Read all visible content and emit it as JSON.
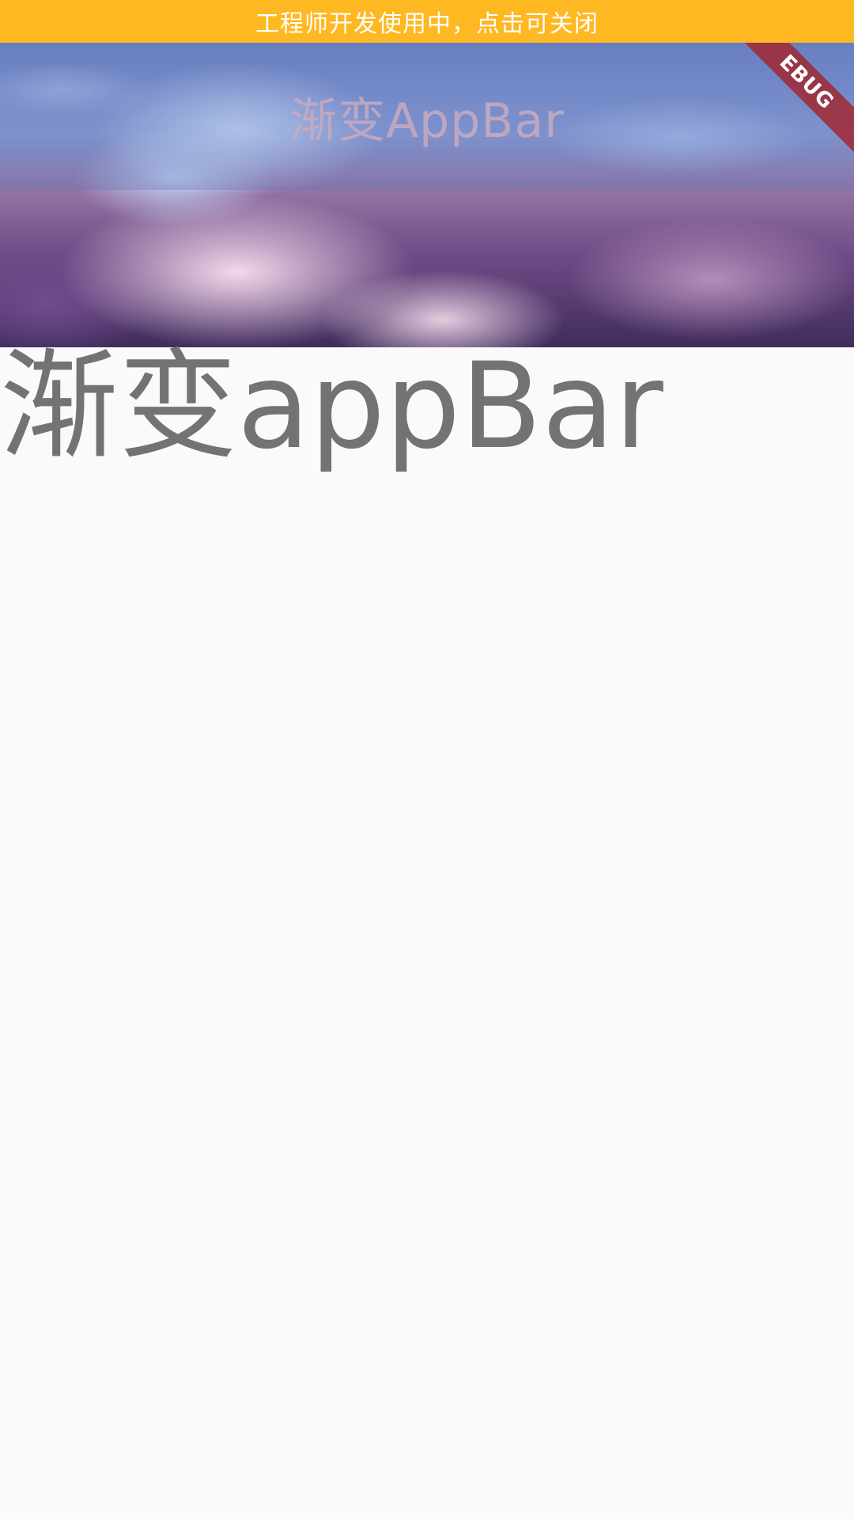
{
  "banner": {
    "text": "工程师开发使用中，点击可关闭",
    "bg_color": "#FEB822"
  },
  "appbar": {
    "title": "渐变AppBar",
    "background": "sky-clouds-image"
  },
  "debug_ribbon": {
    "text": "EBUG"
  },
  "main": {
    "heading": "渐变appBar"
  }
}
